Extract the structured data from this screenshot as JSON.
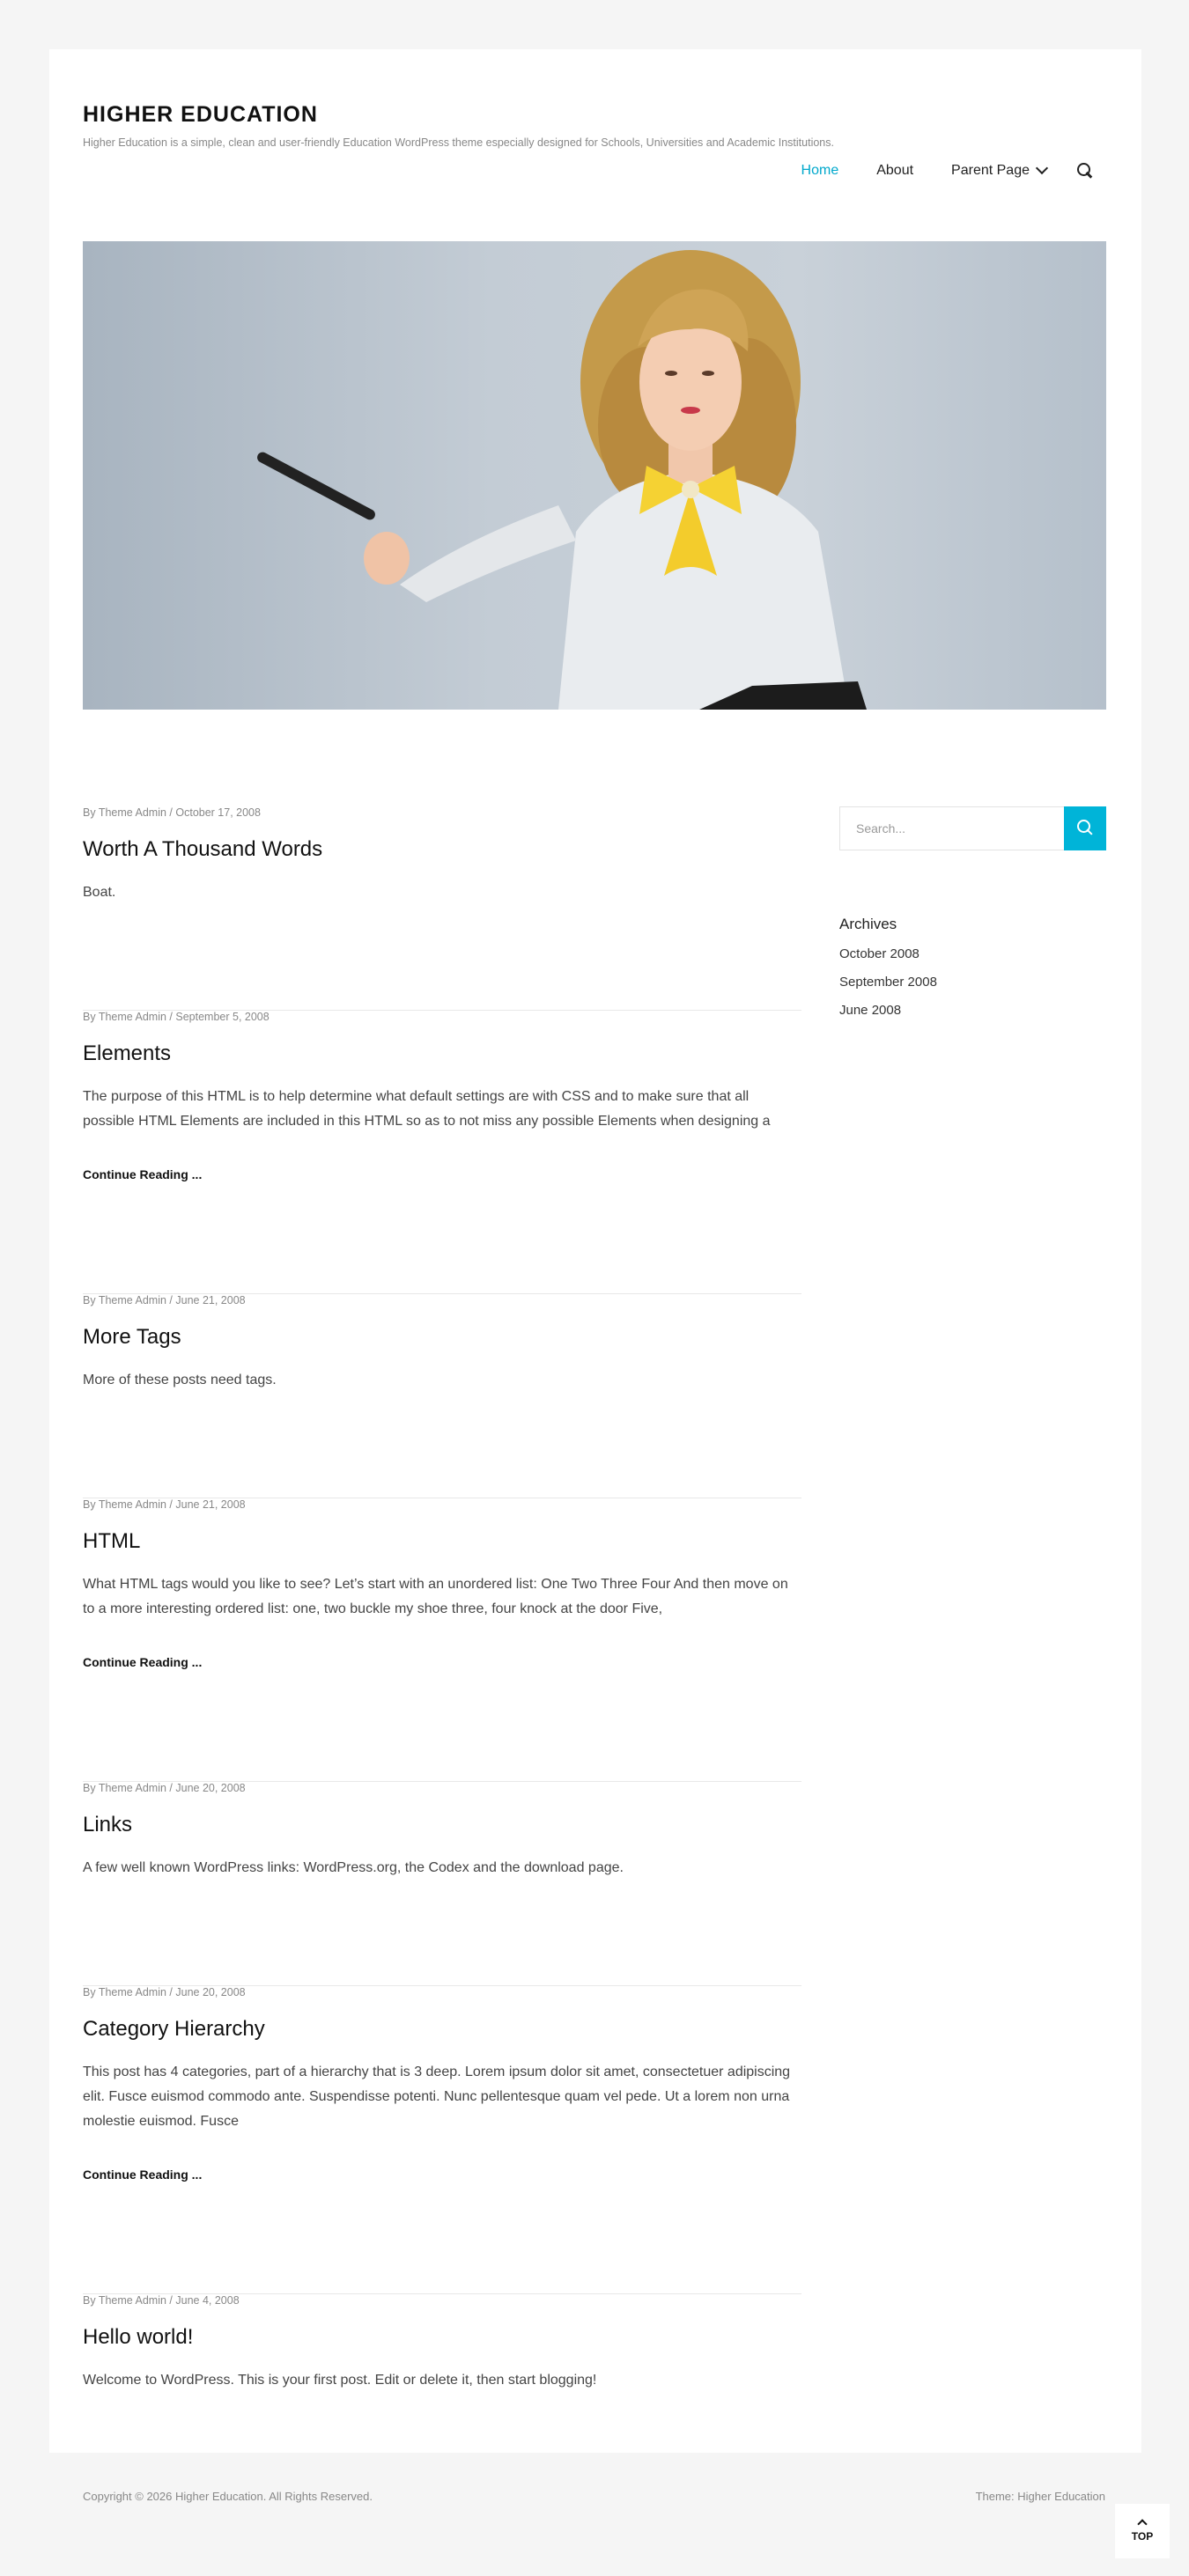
{
  "site": {
    "title": "HIGHER EDUCATION",
    "description": "Higher Education is a simple, clean and user-friendly Education WordPress theme especially designed for Schools, Universities and Academic Institutions."
  },
  "nav": {
    "items": [
      {
        "label": "Home",
        "active": true
      },
      {
        "label": "About"
      },
      {
        "label": "Parent Page"
      }
    ],
    "search_icon": "search-icon"
  },
  "posts": [
    {
      "meta": "By Theme Admin / October 17, 2008",
      "title": "Worth A Thousand Words",
      "excerpt": "Boat.",
      "more": ""
    },
    {
      "meta": "By Theme Admin / September 5, 2008",
      "title": "Elements",
      "excerpt": "The purpose of this HTML is to help determine what default settings are with CSS and to make sure that all possible HTML Elements are included in this HTML so as to not miss any possible Elements when designing a",
      "more": "Continue Reading ..."
    },
    {
      "meta": "By Theme Admin / June 21, 2008",
      "title": "More Tags",
      "excerpt": "More of these posts need tags.",
      "more": ""
    },
    {
      "meta": "By Theme Admin / June 21, 2008",
      "title": "HTML",
      "excerpt": "What HTML tags would you like to see? Let’s start with an unordered list: One Two Three Four And then move on to a more interesting ordered list: one, two buckle my shoe three, four knock at the door Five,",
      "more": "Continue Reading ..."
    },
    {
      "meta": "By Theme Admin / June 20, 2008",
      "title": "Links",
      "excerpt": "A few well known WordPress links: WordPress.org, the Codex and the download page.",
      "more": ""
    },
    {
      "meta": "By Theme Admin / June 20, 2008",
      "title": "Category Hierarchy",
      "excerpt": "This post has 4 categories, part of a hierarchy that is 3 deep. Lorem ipsum dolor sit amet, consectetuer adipiscing elit. Fusce euismod commodo ante. Suspendisse potenti. Nunc pellentesque quam vel pede. Ut a lorem non urna molestie euismod. Fusce",
      "more": "Continue Reading ..."
    },
    {
      "meta": "By Theme Admin / June 4, 2008",
      "title": "Hello world!",
      "excerpt": "Welcome to WordPress. This is your first post. Edit or delete it, then start blogging!",
      "more": ""
    }
  ],
  "sidebar": {
    "search_placeholder": "Search...",
    "archives_title": "Archives",
    "archives": [
      "October 2008",
      "September 2008",
      "June 2008"
    ]
  },
  "footer": {
    "copyright": "Copyright © 2026 Higher Education. All Rights Reserved.",
    "theme": "Theme: Higher Education",
    "top_label": "TOP"
  },
  "colors": {
    "accent": "#00b4d8",
    "page_bg": "#f5f5f5"
  }
}
